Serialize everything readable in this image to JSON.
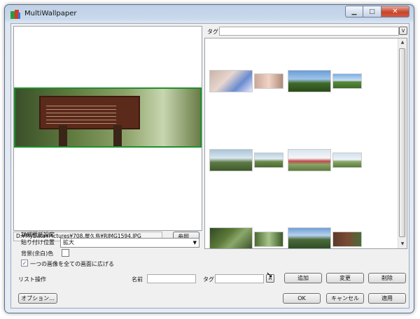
{
  "window": {
    "title": "MultiWallpaper",
    "caption_buttons": [
      "minimize",
      "maximize",
      "close"
    ]
  },
  "left": {
    "path": "D:¥MyData¥Pictures¥708.屋久島¥RIMG1594.JPG",
    "browse_label": "参照...",
    "detail_label": "詳細壁紙設定",
    "position_label": "貼り付け位置",
    "position_value": "拡大",
    "bgcolor_label": "背景(余白)色",
    "span_label": "一つの画像を全ての画面に広げる",
    "span_checked": true
  },
  "right": {
    "tag_label": "タグ",
    "tag_value": "",
    "tag_button": "V"
  },
  "list_ops": {
    "label": "リスト操作",
    "name_label": "名前",
    "tag_label": "タグ",
    "tag_button": "A",
    "add": "追加",
    "change": "変更",
    "delete": "削除"
  },
  "footer": {
    "options": "オプション...",
    "ok": "OK",
    "cancel": "キャンセル",
    "apply": "適用"
  },
  "colors": {
    "accent_border": "#1f8f2c",
    "close_button": "#c8442c"
  }
}
